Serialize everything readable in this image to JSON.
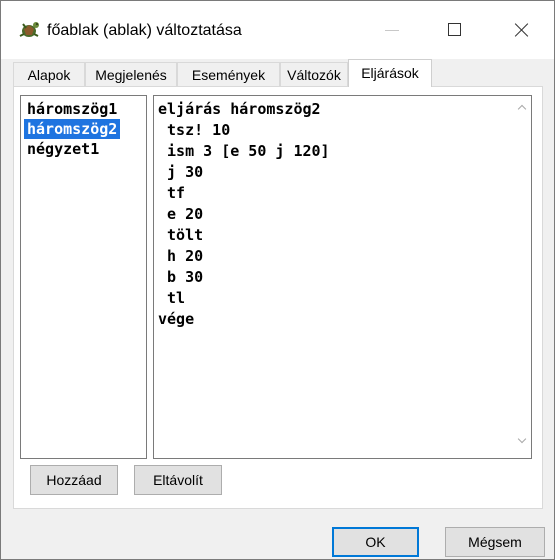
{
  "window": {
    "title": "főablak (ablak) változtatása",
    "icon": "turtle-logo-icon",
    "controls": [
      "minimize",
      "maximize",
      "close"
    ]
  },
  "tabs": [
    {
      "label": "Alapok",
      "active": false
    },
    {
      "label": "Megjelenés",
      "active": false
    },
    {
      "label": "Események",
      "active": false
    },
    {
      "label": "Változók",
      "active": false
    },
    {
      "label": "Eljárások",
      "active": true
    }
  ],
  "procedures": {
    "items": [
      {
        "label": "háromszög1",
        "selected": false
      },
      {
        "label": "háromszög2",
        "selected": true
      },
      {
        "label": "négyzet1",
        "selected": false
      }
    ]
  },
  "editor": {
    "lines": [
      "eljárás háromszög2",
      " tsz! 10",
      " ism 3 [e 50 j 120]",
      " j 30",
      " tf",
      " e 20",
      " tölt",
      " h 20",
      " b 30",
      " tl",
      "vége"
    ]
  },
  "buttons": {
    "add": "Hozzáad",
    "remove": "Eltávolít",
    "ok": "OK",
    "cancel": "Mégsem"
  },
  "colors": {
    "selection": "#1e74e0",
    "default_button_border": "#0078d7"
  }
}
